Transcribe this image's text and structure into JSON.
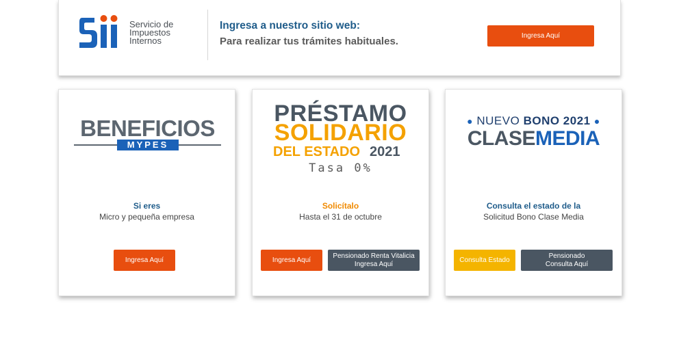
{
  "banner": {
    "logo_lines": [
      "Servicio de",
      "Impuestos",
      "Internos"
    ],
    "title": "Ingresa a nuestro sitio web:",
    "subtitle": "Para realizar tus trámites habituales.",
    "button_label": "Ingresa Aquí"
  },
  "cards": [
    {
      "logo_word": "BENEFICIOS",
      "logo_tag": "MYPES",
      "highlight": "Si eres",
      "line": "Micro y pequeña empresa",
      "buttons": [
        {
          "label": "Ingresa Aquí"
        }
      ]
    },
    {
      "logo_line1": "PRÉSTAMO",
      "logo_line2": "SOLIDARIO",
      "logo_line3a": "DEL ESTADO",
      "logo_line3b": "2021",
      "logo_rate": "Tasa 0%",
      "highlight": "Solicítalo",
      "line": "Hasta el 31 de octubre",
      "buttons": [
        {
          "label": "Ingresa Aquí"
        },
        {
          "label_line1": "Pensionado Renta Vitalicia",
          "label_line2": "Ingresa Aquí"
        }
      ]
    },
    {
      "logo_nuevo": "NUEVO",
      "logo_bono": "BONO 2021",
      "logo_clase": "CLASE",
      "logo_media": "MEDIA",
      "highlight": "Consulta el estado de la",
      "line": "Solicitud Bono Clase Media",
      "buttons": [
        {
          "label": "Consulta Estado"
        },
        {
          "label_line1": "Pensionado",
          "label_line2": "Consulta Aquí"
        }
      ]
    }
  ],
  "colors": {
    "brand_blue": "#1f5c8a",
    "accent_orange": "#e84e0f",
    "button_gray": "#4a5662",
    "button_yellow": "#f4b400",
    "highlight_orange": "#f08a00"
  }
}
